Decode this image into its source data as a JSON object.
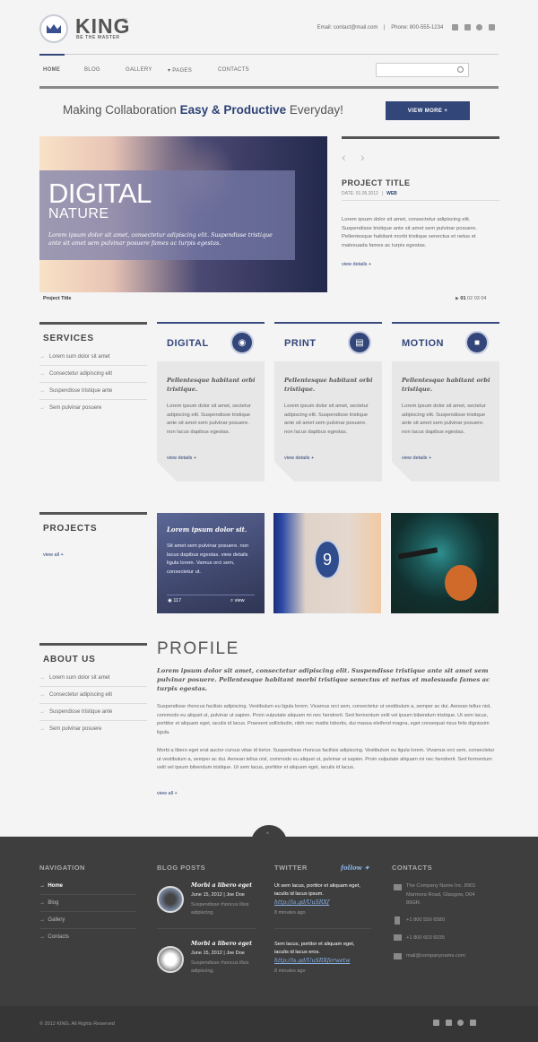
{
  "header": {
    "brand": "KING",
    "tm": "TM",
    "tagline": "BE THE MASTER",
    "email": "Email:  contact@mail.com",
    "phone": "Phone:  800-555-1234"
  },
  "nav": {
    "items": [
      "HOME",
      "BLOG",
      "GALLERY",
      "PAGES",
      "CONTACTS"
    ],
    "pages_arrow": "▾"
  },
  "hero": {
    "tagline_a": "Making Collaboration ",
    "tagline_b": "Easy & Productive",
    "tagline_c": " Everyday!",
    "button": "VIEW MORE +"
  },
  "slider": {
    "title1": "DIGITAL",
    "title2": "NATURE",
    "text": "Lorem ipsum dolor sit amet, consectetur adipiscing elit. Suspendisse tristique ante sit amet sem pulvinar posuere fames ac turpis egestas.",
    "caption": "Project Title",
    "pages": [
      "01",
      "02",
      "03",
      "04"
    ]
  },
  "project": {
    "title": "PROJECT TITLE",
    "date": "DATE: 01.05.2012",
    "tag": "WEB",
    "body": "Lorem ipsum dolor sit amet, consectetur adipiscing elit. Suspendisse tristique ante sit amet sem pulvinar posuere. Pellentesque habitant morbi tristique senectus et netus et malesuada fames ac turpis egestas.",
    "details": "view details +"
  },
  "services": {
    "title": "SERVICES",
    "items": [
      "Lorem sum dolor sit amet",
      "Consectetur adipiscing elit",
      "Suspendisse tristique ante",
      "Sem pulvinar posuere"
    ]
  },
  "cards": [
    {
      "title": "DIGITAL",
      "lead": "Pellentesque habitant orbi tristique.",
      "body": "Lorem ipsum dolor sit amet, sectetur adipiscing elit. Suspendisse tristique ante sit amet sem pulvinar posuere. non lacus dapibus egestas.",
      "link": "view details +"
    },
    {
      "title": "PRINT",
      "lead": "Pellentesque habitant orbi tristique.",
      "body": "Lorem ipsum dolor sit amet, sectetur adipiscing elit. Suspendisse tristique ante sit amet sem pulvinar posuere. non lacus dapibus egestas.",
      "link": "view details +"
    },
    {
      "title": "MOTION",
      "lead": "Pellentesque habitant orbi tristique.",
      "body": "Lorem ipsum dolor sit amet, sectetur adipiscing elit. Suspendisse tristique ante sit amet sem pulvinar posuere. non lacus dapibus egestas.",
      "link": "view details +"
    }
  ],
  "projects": {
    "title": "PROJECTS",
    "link": "view all +",
    "overlay_title": "Lorem ipsum dolor sit.",
    "overlay_body": "Sit amet sem pulvinar posuere. non lacus dapibus egestas. view details ligula lorem. Vamus orci sem, consectetur ut.",
    "views": "117",
    "view": "view",
    "tile2_number": "9"
  },
  "about": {
    "title": "ABOUT US",
    "items": [
      "Lorem sum dolor sit amet",
      "Consectetur adipiscing elit",
      "Suspendisse tristique ante",
      "Sem pulvinar posuere"
    ]
  },
  "profile": {
    "title": "PROFILE",
    "lead": "Lorem ipsum dolor sit amet, consectetur adipiscing elit. Suspendisse tristique ante sit amet sem pulvinar posuere. Pellentesque habitant morbi tristique senectus et netus et malesuada fames ac turpis egestas.",
    "p1": "Suspendisse rhoncus facilisis adipiscing. Vestibulum eu ligula lorem. Vivamus orci sem, consectetur ut vestibulum a, semper ac dui. Aenean tellus nisl, commodo eu aliquet ut, pulvinar ut sapien. Proin vulputate aliquam mi nec hendrerit. Sed fermentum velit vel ipsum bibendum tristique. Ut sem lacus, porttitor et aliquam eget, iaculis id lacus. Praesent sollicitudin, nibh nec mattis lobortis, dui massa eleifend magna, eget consequat risus felis dignissim ligula.",
    "p2": "Morbi a libero eget erat auctor cursus vitae id tortor. Suspendisse rhoncus facilisis adipiscing. Vestibulum eu ligula lorem. Vivamus orci sem, consectetur ut vestibulum a, semper ac dui. Aenean tellus nisl, commodo eu aliquet ut, pulvinar ut sapien. Proin vulputate aliquam mi nec hendrerit. Sed fermentum velit vel ipsum bibendum tristique. Ut sem lacus, porttitor et aliquam eget, iaculis id lacus.",
    "link": "view all +"
  },
  "footer": {
    "nav_title": "NAVIGATION",
    "nav": [
      "Home",
      "Blog",
      "Gallery",
      "Contacts"
    ],
    "blog_title": "BLOG POSTS",
    "posts": [
      {
        "title": "Morbi a libero eget",
        "meta": "June 15, 2012  |  Joe Doe",
        "text": "Suspendisse rhoncus illsis adipiscing."
      },
      {
        "title": "Morbi a libero eget",
        "meta": "June 15, 2012  |  Joe Doe",
        "text": "Suspendisse rhoncus illsis adipiscing."
      }
    ],
    "twitter_title": "TWITTER",
    "follow": "follow",
    "tweets": [
      {
        "text": "Ut sem lacus, portitor et aliquam eget, iaculis id lacus ipsum.",
        "link": "http://is.gd/UuSRXf",
        "time": "8 minutes ago"
      },
      {
        "text": "Sem lacus, portitor et aliquam eget, iaculis id lacus eros.",
        "link": "http://is.gd/UuSRXferwetw",
        "time": "8 minutes ago"
      }
    ],
    "contacts_title": "CONTACTS",
    "address": "The Company Name Inc. 8901 Marmora Road, Glasgow, D04 89GR.",
    "phone1": "+1 800 559 6580",
    "phone2": "+1 800 603 6035",
    "email": "mail@companyname.com",
    "copyright": "© 2012 KING. All Rights Reserved"
  }
}
